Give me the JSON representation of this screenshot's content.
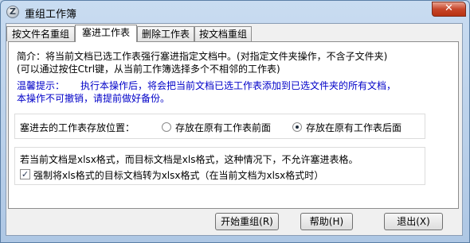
{
  "window": {
    "title": "重组工作簿",
    "icon": "app-icon",
    "close_label": "✕"
  },
  "tabs": [
    {
      "label": "按文件名重组",
      "active": false
    },
    {
      "label": "塞进工作表",
      "active": true
    },
    {
      "label": "删除工作表",
      "active": false
    },
    {
      "label": "按文档重组",
      "active": false
    }
  ],
  "intro": {
    "line1": "简介：将当前文档已选工作表强行塞进指定文档中。(对指定文件夹操作，不含子文件夹)",
    "line2": "(可以通过按住Ctrl键，从当前工作簿选择多个不相邻的工作表)"
  },
  "warning": {
    "label": "温馨提示：",
    "line1": "执行本操作后，将会把当前文档已选工作表添加到已选文件夹的所有文档，",
    "line2": "本操作不可撤销，请提前做好备份。",
    "color": "#0000c8"
  },
  "position": {
    "label": "塞进去的工作表存放位置：",
    "options": [
      {
        "label": "存放在原有工作表前面",
        "selected": false
      },
      {
        "label": "存放在原有工作表后面",
        "selected": true
      }
    ]
  },
  "format": {
    "note": "若当前文档是xlsx格式，而目标文档是xls格式，这种情况下，不允许塞进表格。",
    "checkbox_label": "强制将xls格式的目标文档转为xlsx格式（在当前文档为xlsx格式时）",
    "checked": true
  },
  "buttons": {
    "start": "开始重组(R)",
    "help": "帮助(H)",
    "exit": "退出(X)"
  }
}
